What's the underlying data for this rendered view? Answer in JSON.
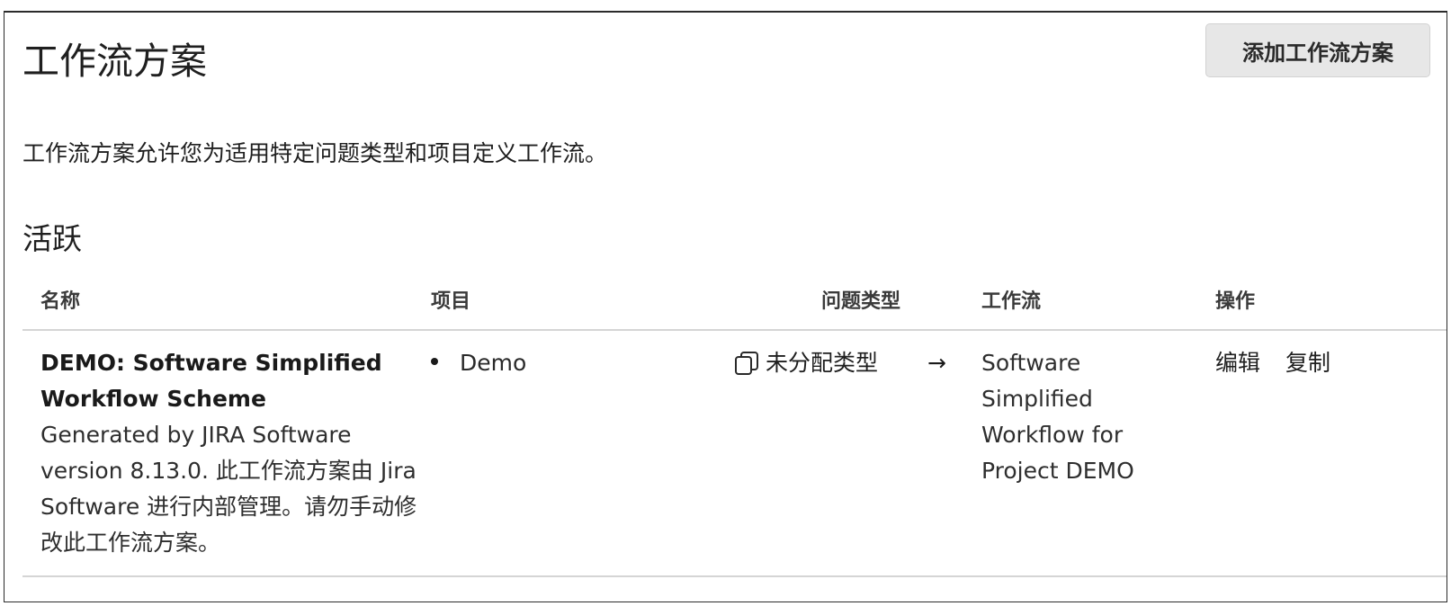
{
  "header": {
    "title": "工作流方案",
    "add_button_label": "添加工作流方案"
  },
  "description": "工作流方案允许您为适用特定问题类型和项目定义工作流。",
  "section_title": "活跃",
  "table": {
    "columns": [
      "名称",
      "项目",
      "问题类型",
      "工作流",
      "操作"
    ],
    "rows": [
      {
        "name": "DEMO: Software Simplified Workflow Scheme",
        "description": "Generated by JIRA Software version 8.13.0. 此工作流方案由 Jira Software 进行内部管理。请勿手动修改此工作流方案。",
        "projects": [
          "Demo"
        ],
        "issue_type": "未分配类型",
        "issue_type_icon": "copy-icon",
        "arrow": "→",
        "workflow": "Software Simplified Workflow for Project DEMO",
        "actions": {
          "edit": "编辑",
          "copy": "复制"
        }
      }
    ]
  },
  "colors": {
    "button_bg": "#e7e7e7",
    "divider": "#d5d5d5",
    "text": "#1f1f1f"
  }
}
